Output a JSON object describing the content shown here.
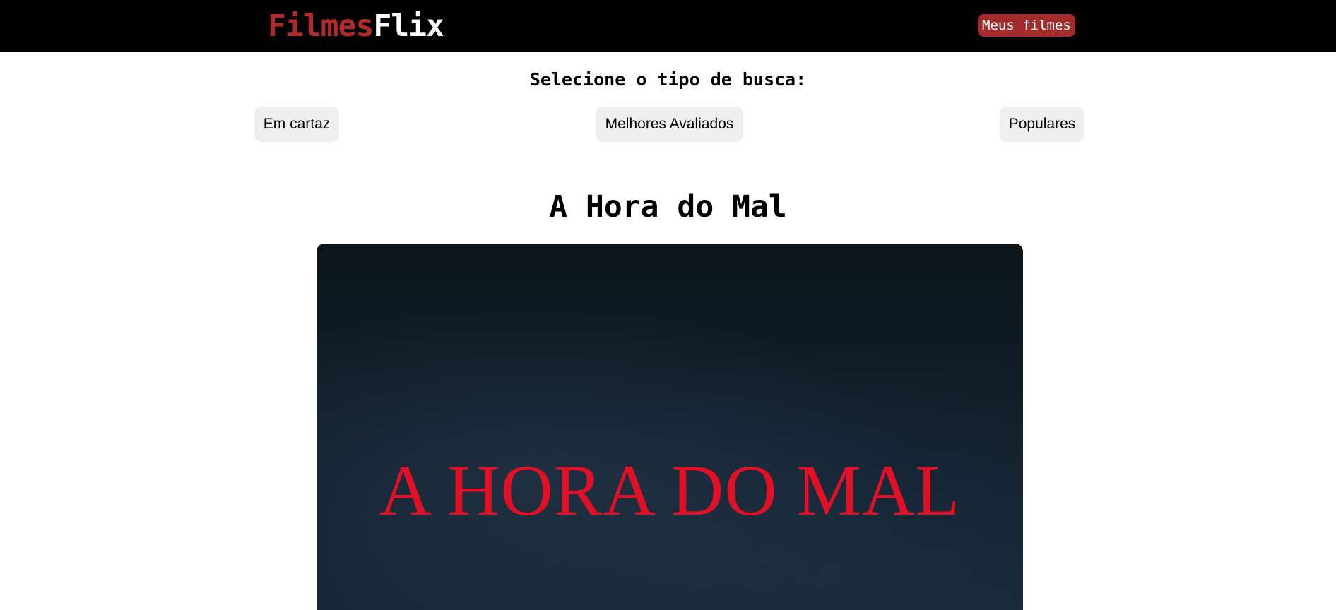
{
  "header": {
    "brand_part1": "Filmes",
    "brand_part2": "Flix",
    "my_movies_label": "Meus filmes"
  },
  "search": {
    "heading": "Selecione o tipo de busca:",
    "options": [
      {
        "label": "Em cartaz"
      },
      {
        "label": "Melhores Avaliados"
      },
      {
        "label": "Populares"
      }
    ]
  },
  "movie": {
    "title": "A Hora do Mal",
    "poster_title": "A HORA DO MAL"
  },
  "colors": {
    "header_bg": "#000000",
    "brand_accent": "#b22a2a",
    "button_accent": "#a42b2b",
    "poster_title": "#e01026"
  }
}
